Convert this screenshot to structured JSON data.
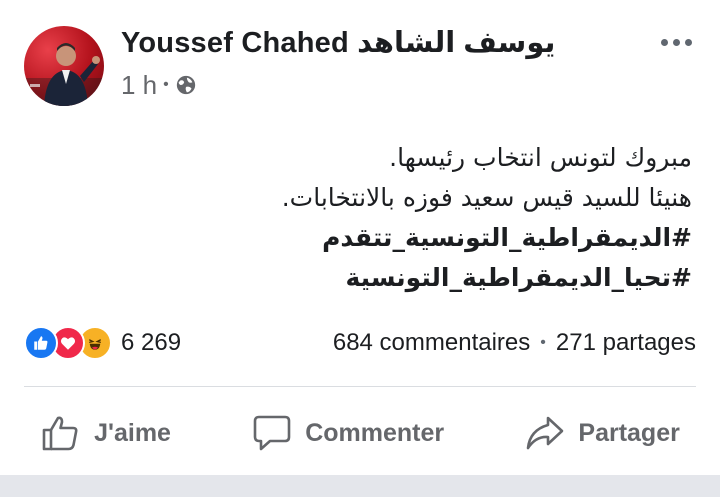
{
  "post": {
    "author_name": "Youssef Chahed يوسف الشاهد",
    "timestamp": "1 h",
    "privacy_icon": "globe-icon",
    "more_icon": "more-options-icon",
    "body_lines": [
      "مبروك لتونس انتخاب رئيسها.",
      "هنيئا للسيد قيس سعيد فوزه بالانتخابات."
    ],
    "hashtags": [
      "#الديمقراطية_التونسية_تتقدم",
      "#تحيا_الديمقراطية_التونسية"
    ]
  },
  "reactions": {
    "icons": [
      "like-reaction-icon",
      "love-reaction-icon",
      "haha-reaction-icon"
    ],
    "count": "6 269",
    "comments": "684 commentaires",
    "shares": "271 partages"
  },
  "actions": {
    "like_label": "J'aime",
    "comment_label": "Commenter",
    "share_label": "Partager"
  },
  "colors": {
    "like_blue": "#1877f2",
    "love_red": "#f0284a",
    "haha_yellow": "#f7b125",
    "secondary_text": "#65676b"
  }
}
